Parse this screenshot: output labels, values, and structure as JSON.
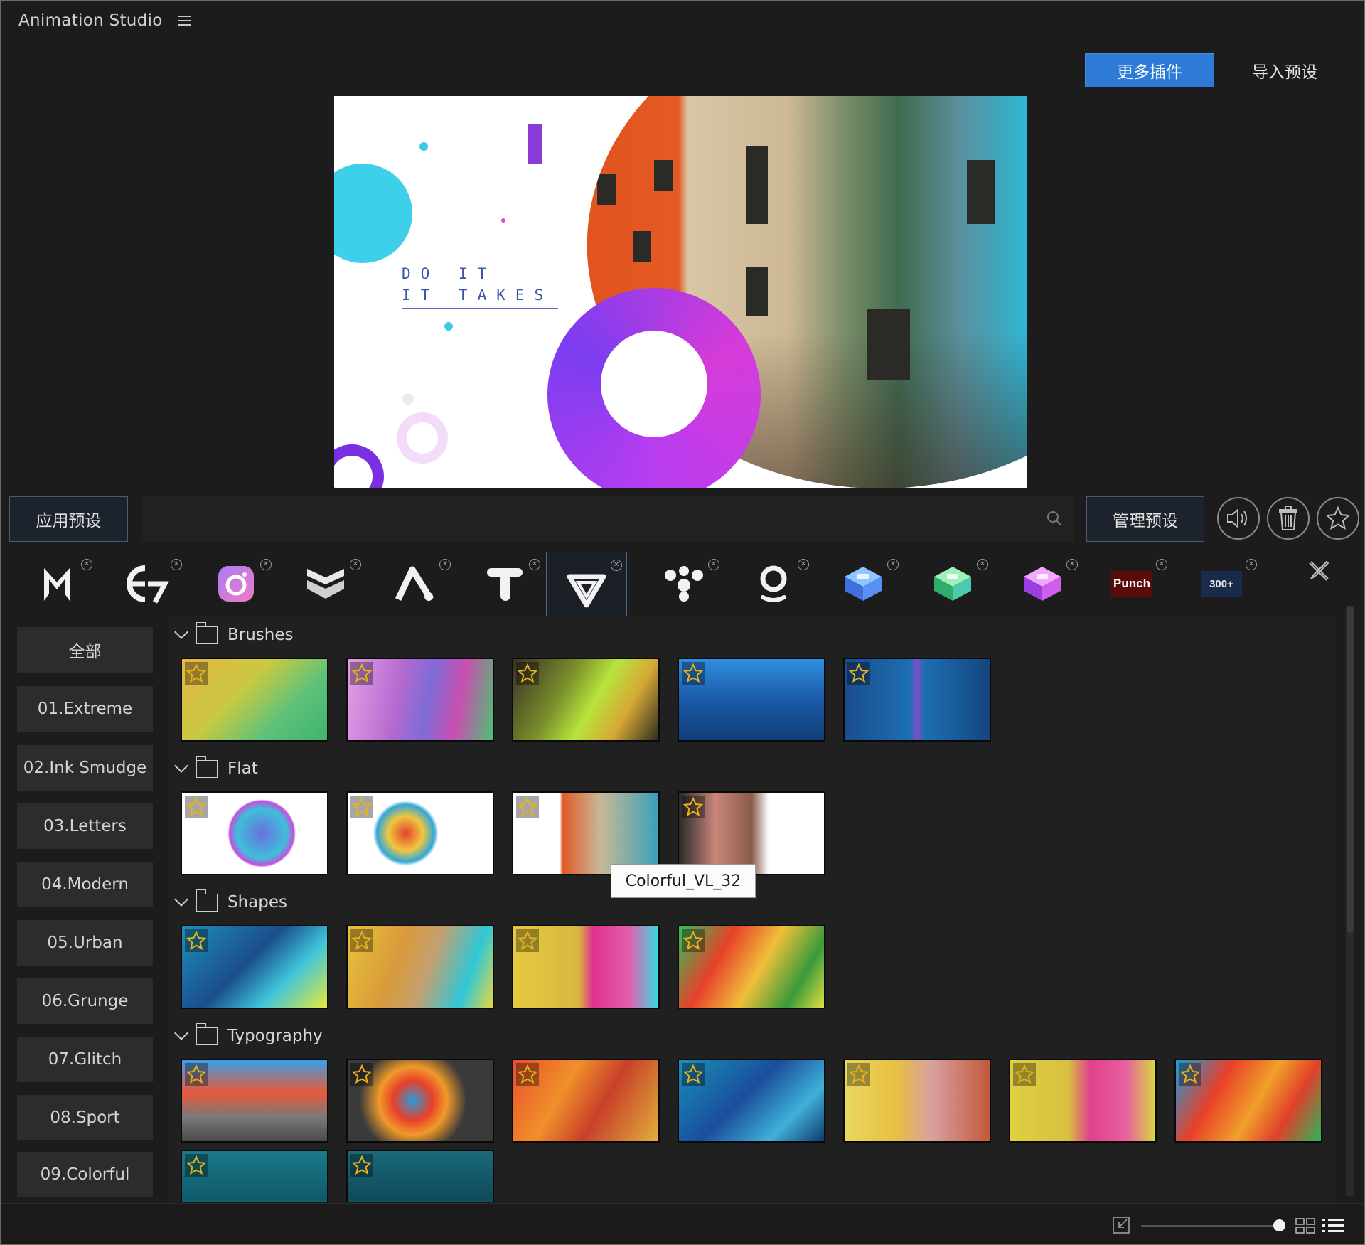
{
  "app": {
    "title": "Animation Studio"
  },
  "header": {
    "more_plugins": "更多插件",
    "import_presets": "导入预设"
  },
  "preview": {
    "text_line1": "DO IT__",
    "text_line2": "IT TAKES"
  },
  "toolbar": {
    "apply_preset": "应用预设",
    "search_value": "",
    "manage_presets": "管理预设"
  },
  "plugins": [
    {
      "name": "m-logo-icon",
      "active": false
    },
    {
      "name": "e7-logo-icon",
      "active": false
    },
    {
      "name": "camera-logo-icon",
      "active": false
    },
    {
      "name": "chevron-stack-logo-icon",
      "active": false
    },
    {
      "name": "a-logo-icon",
      "active": false
    },
    {
      "name": "t-logo-icon",
      "active": false
    },
    {
      "name": "v-logo-icon",
      "active": true
    },
    {
      "name": "molecule-logo-icon",
      "active": false
    },
    {
      "name": "o-logo-icon",
      "active": false
    },
    {
      "name": "blue-cube-logo-icon",
      "active": false
    },
    {
      "name": "green-cube-logo-icon",
      "active": false
    },
    {
      "name": "pink-cube-logo-icon",
      "active": false
    },
    {
      "name": "punch-logo-icon",
      "label": "Punch",
      "active": false
    },
    {
      "name": "300-logo-icon",
      "label": "300+",
      "active": false
    }
  ],
  "categories": [
    "全部",
    "01.Extreme",
    "02.Ink Smudge",
    "03.Letters",
    "04.Modern",
    "05.Urban",
    "06.Grunge",
    "07.Glitch",
    "08.Sport",
    "09.Colorful"
  ],
  "groups": [
    {
      "name": "Brushes",
      "count": 5
    },
    {
      "name": "Flat",
      "count": 4
    },
    {
      "name": "Shapes",
      "count": 4
    },
    {
      "name": "Typography",
      "count": 9
    }
  ],
  "tooltip": "Colorful_VL_32",
  "colors": {
    "accent": "#2d7bd6",
    "star": "#e8b21c",
    "background": "#1c1c1c"
  }
}
